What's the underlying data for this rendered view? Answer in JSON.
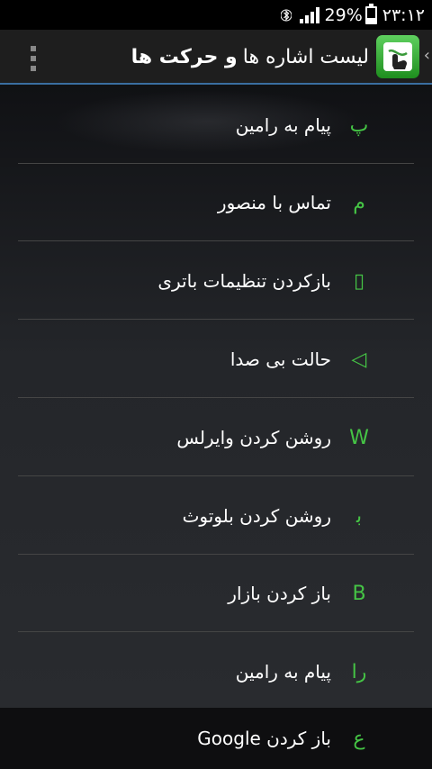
{
  "status_bar": {
    "time": "۲۳:۱۲",
    "battery": "29%",
    "battery_level": 0.29
  },
  "action_bar": {
    "title_main": "لیست اشاره ها",
    "title_bold": "و حرکت ها"
  },
  "items": [
    {
      "glyph": "ﭖ",
      "label": "پیام به رامین"
    },
    {
      "glyph": "م",
      "label": "تماس با منصور"
    },
    {
      "glyph": "▯",
      "label": "بازکردن تنظیمات باتری"
    },
    {
      "glyph": "◁",
      "label": "حالت بی صدا"
    },
    {
      "glyph": "W",
      "label": "روشن کردن وایرلس"
    },
    {
      "glyph": "ﺑ",
      "label": "روشن کردن بلوتوث"
    },
    {
      "glyph": "B",
      "label": "باز کردن بازار"
    },
    {
      "glyph": "ﺭا",
      "label": "پیام به رامین"
    },
    {
      "glyph": "ع",
      "label": "باز کردن Google"
    }
  ],
  "icons": {
    "bluetooth": "bluetooth-icon",
    "signal": "signal-icon",
    "battery": "battery-icon",
    "overflow": "overflow-menu-icon",
    "app": "gesture-app-icon"
  },
  "colors": {
    "accent": "#45c445",
    "divider": "#454545",
    "actionbar_border": "#3a6ea0"
  }
}
